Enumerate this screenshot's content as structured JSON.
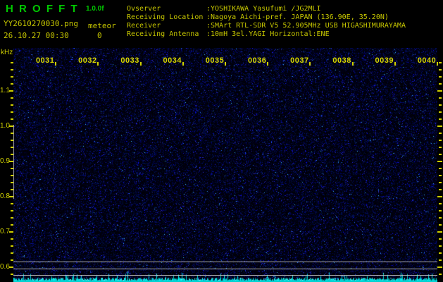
{
  "title": {
    "app": "H R O F F T",
    "version": "1.0.0f"
  },
  "file_info": {
    "filename": "YY2610270030.png",
    "mode": "meteor",
    "datetime": "26.10.27 00:30",
    "count": "0"
  },
  "observer_info": [
    {
      "label": "Ovserver",
      "value": ":YOSHIKAWA Yasufumi /JG2MLI"
    },
    {
      "label": "Receiving Location",
      "value": ":Nagoya Aichi-pref. JAPAN (136.90E, 35.20N)"
    },
    {
      "label": "Receiver",
      "value": ":SMArt RTL-SDR V5 52.905MHz USB HIGASHIMURAYAMA"
    },
    {
      "label": "Receiving Antenna",
      "value": ":10mH 3el.YAGI Horizontal:ENE"
    }
  ],
  "chart_data": {
    "type": "heatmap",
    "title": "HROFFT meteor radio echo spectrogram (10 minute frame)",
    "ylabel": "kHz",
    "y_ticks": [
      "1.1",
      "1.0",
      "0.9",
      "0.8",
      "0.7",
      "0.6"
    ],
    "ylim_khz": [
      0.56,
      1.22
    ],
    "x_ticks": [
      "0031",
      "0032",
      "0033",
      "0034",
      "0035",
      "0036",
      "0037",
      "0038",
      "0039",
      "0040"
    ],
    "x_range_hhmm": [
      "0030",
      "0040"
    ],
    "meteor_echo_count": 0,
    "content": "dark-blue background noise only, no meteor echo streaks",
    "carrier_lines_khz": [
      0.62,
      0.6,
      0.58
    ],
    "signal_level_strip": "cyan noise-level bar graph along bottom edge"
  },
  "colors": {
    "background": "#000000",
    "accent_green": "#00c800",
    "text_yellow": "#c8c800",
    "axis_yellow": "#d0d000",
    "noise_blue": "#0000c8",
    "carrier_grey": "#c4c4c4",
    "level_cyan": "#00dcdc"
  }
}
